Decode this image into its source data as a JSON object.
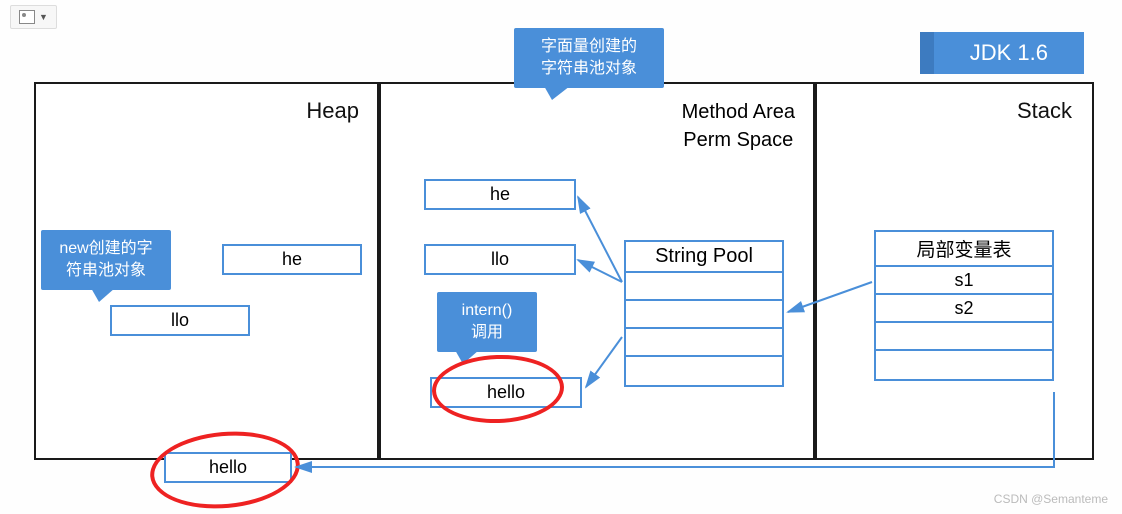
{
  "jdk_version": "JDK 1.6",
  "panels": {
    "heap": "Heap",
    "method_area_l1": "Method Area",
    "method_area_l2": "Perm Space",
    "stack": "Stack"
  },
  "callouts": {
    "new_obj_l1": "new创建的字",
    "new_obj_l2": "符串池对象",
    "literal_l1": "字面量创建的",
    "literal_l2": "字符串池对象",
    "intern_l1": "intern()",
    "intern_l2": "调用"
  },
  "heap_boxes": {
    "he": "he",
    "llo": "llo",
    "hello": "hello"
  },
  "method_area_boxes": {
    "he": "he",
    "llo": "llo",
    "hello": "hello"
  },
  "string_pool_title": "String Pool",
  "local_vars": {
    "title": "局部变量表",
    "s1": "s1",
    "s2": "s2"
  },
  "watermark": "CSDN @Semanteme"
}
